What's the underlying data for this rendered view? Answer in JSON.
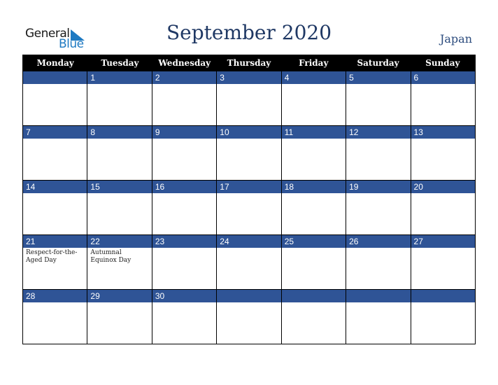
{
  "logo": {
    "line1": "General",
    "line2": "Blue"
  },
  "title": "September 2020",
  "country": "Japan",
  "weekdays": [
    "Monday",
    "Tuesday",
    "Wednesday",
    "Thursday",
    "Friday",
    "Saturday",
    "Sunday"
  ],
  "weeks": [
    [
      {
        "day": "",
        "note": ""
      },
      {
        "day": "1",
        "note": ""
      },
      {
        "day": "2",
        "note": ""
      },
      {
        "day": "3",
        "note": ""
      },
      {
        "day": "4",
        "note": ""
      },
      {
        "day": "5",
        "note": ""
      },
      {
        "day": "6",
        "note": ""
      }
    ],
    [
      {
        "day": "7",
        "note": ""
      },
      {
        "day": "8",
        "note": ""
      },
      {
        "day": "9",
        "note": ""
      },
      {
        "day": "10",
        "note": ""
      },
      {
        "day": "11",
        "note": ""
      },
      {
        "day": "12",
        "note": ""
      },
      {
        "day": "13",
        "note": ""
      }
    ],
    [
      {
        "day": "14",
        "note": ""
      },
      {
        "day": "15",
        "note": ""
      },
      {
        "day": "16",
        "note": ""
      },
      {
        "day": "17",
        "note": ""
      },
      {
        "day": "18",
        "note": ""
      },
      {
        "day": "19",
        "note": ""
      },
      {
        "day": "20",
        "note": ""
      }
    ],
    [
      {
        "day": "21",
        "note": "Respect-for-the-Aged Day"
      },
      {
        "day": "22",
        "note": "Autumnal Equinox Day"
      },
      {
        "day": "23",
        "note": ""
      },
      {
        "day": "24",
        "note": ""
      },
      {
        "day": "25",
        "note": ""
      },
      {
        "day": "26",
        "note": ""
      },
      {
        "day": "27",
        "note": ""
      }
    ],
    [
      {
        "day": "28",
        "note": ""
      },
      {
        "day": "29",
        "note": ""
      },
      {
        "day": "30",
        "note": ""
      },
      {
        "day": "",
        "note": ""
      },
      {
        "day": "",
        "note": ""
      },
      {
        "day": "",
        "note": ""
      },
      {
        "day": "",
        "note": ""
      }
    ]
  ],
  "colors": {
    "band": "#2f5496",
    "header": "#000000",
    "title": "#1f3864",
    "logo_blue": "#1f7ac2"
  }
}
